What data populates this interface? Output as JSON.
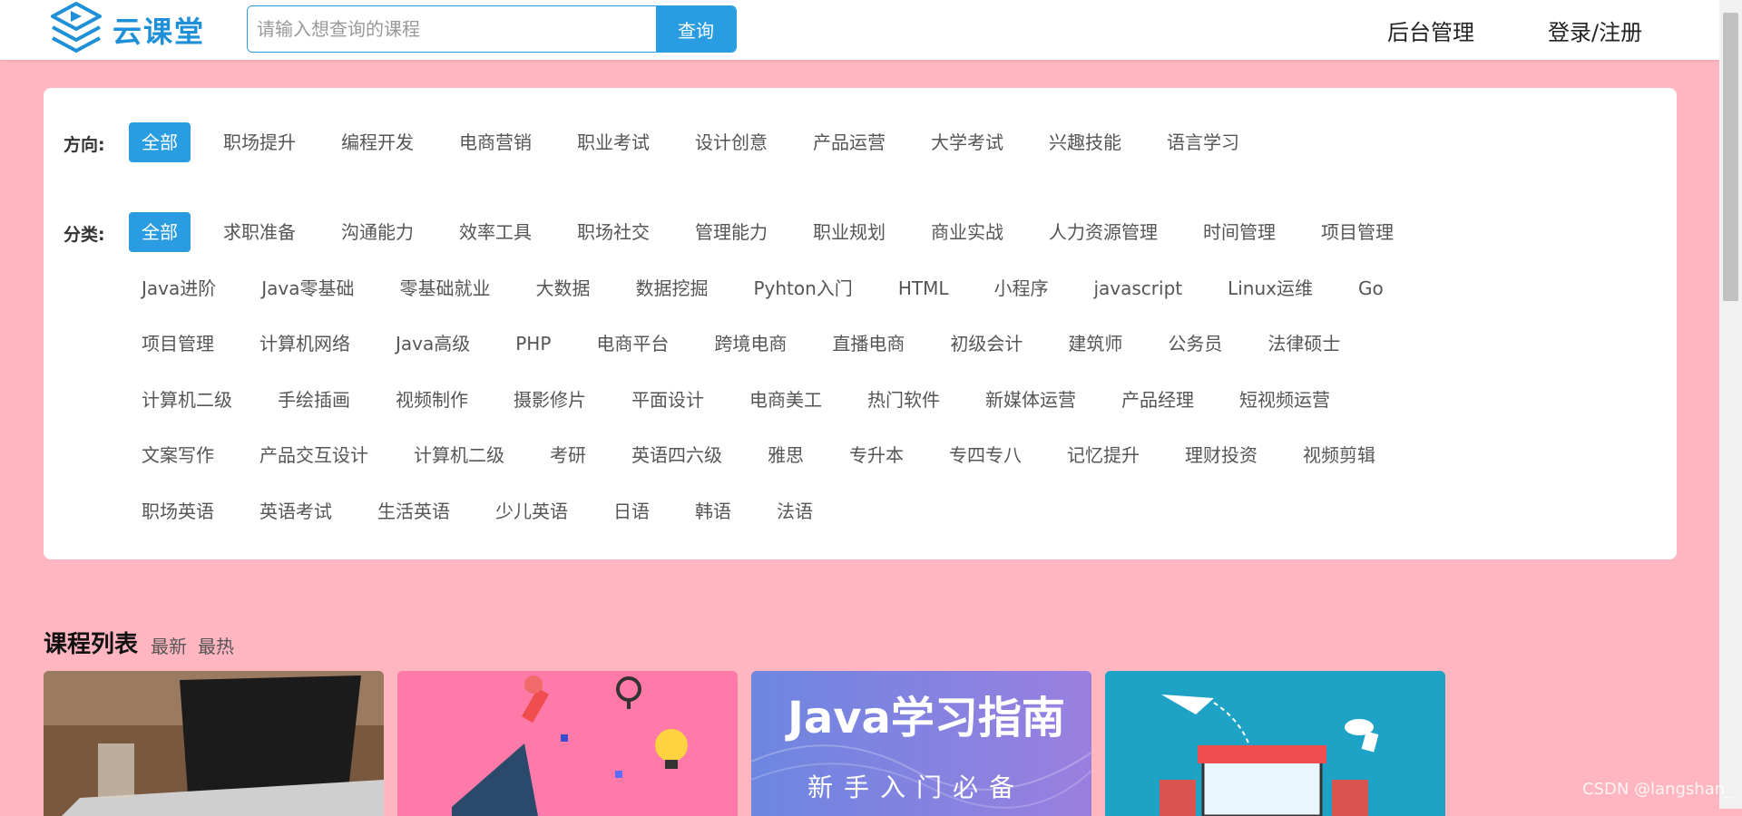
{
  "header": {
    "logo_text": "云课堂",
    "search_placeholder": "请输入想查询的课程",
    "search_button": "查询",
    "admin_link": "后台管理",
    "login_link": "登录/注册"
  },
  "filters": {
    "direction_label": "方向:",
    "direction_items": [
      "全部",
      "职场提升",
      "编程开发",
      "电商营销",
      "职业考试",
      "设计创意",
      "产品运营",
      "大学考试",
      "兴趣技能",
      "语言学习"
    ],
    "category_label": "分类:",
    "category_rows": [
      [
        "全部",
        "求职准备",
        "沟通能力",
        "效率工具",
        "职场社交",
        "管理能力",
        "职业规划",
        "商业实战",
        "人力资源管理",
        "时间管理",
        "项目管理"
      ],
      [
        "Java进阶",
        "Java零基础",
        "零基础就业",
        "大数据",
        "数据挖掘",
        "Pyhton入门",
        "HTML",
        "小程序",
        "javascript",
        "Linux运维",
        "Go"
      ],
      [
        "项目管理",
        "计算机网络",
        "Java高级",
        "PHP",
        "电商平台",
        "跨境电商",
        "直播电商",
        "初级会计",
        "建筑师",
        "公务员",
        "法律硕士"
      ],
      [
        "计算机二级",
        "手绘插画",
        "视频制作",
        "摄影修片",
        "平面设计",
        "电商美工",
        "热门软件",
        "新媒体运营",
        "产品经理",
        "短视频运营"
      ],
      [
        "文案写作",
        "产品交互设计",
        "计算机二级",
        "考研",
        "英语四六级",
        "雅思",
        "专升本",
        "专四专八",
        "记忆提升",
        "理财投资",
        "视频剪辑"
      ],
      [
        "职场英语",
        "英语考试",
        "生活英语",
        "少儿英语",
        "日语",
        "韩语",
        "法语"
      ]
    ]
  },
  "course_list": {
    "title": "课程列表",
    "sort_newest": "最新",
    "sort_hottest": "最热",
    "cards": [
      {
        "image": "laptop-photo"
      },
      {
        "image": "megaphone-illustration"
      },
      {
        "image": "java-banner",
        "banner_title": "Java学习指南",
        "banner_subtitle": "新手入门必备"
      },
      {
        "image": "ecommerce-illustration"
      }
    ]
  },
  "watermark": "CSDN @langshan_",
  "colors": {
    "accent": "#2a9de2",
    "background": "#ffb6c1",
    "panel": "#ffffff"
  }
}
